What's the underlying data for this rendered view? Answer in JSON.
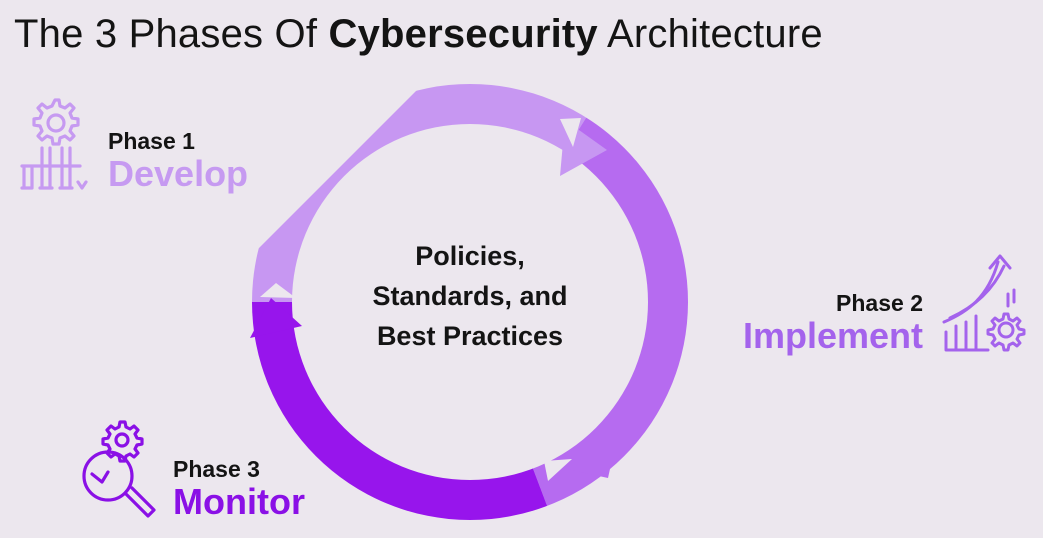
{
  "title": {
    "prefix": "The 3 Phases Of",
    "emphasis": "Cybersecurity",
    "suffix": "Architecture"
  },
  "center": {
    "line1": "Policies,",
    "line2": "Standards, and",
    "line3": "Best Practices"
  },
  "phases": [
    {
      "number": "Phase 1",
      "name": "Develop",
      "color": "#C69AF1",
      "icon": "gear-pillars-icon"
    },
    {
      "number": "Phase 2",
      "name": "Implement",
      "color": "#A463EC",
      "icon": "growth-gear-icon"
    },
    {
      "number": "Phase 3",
      "name": "Monitor",
      "color": "#8A10E6",
      "icon": "magnifier-gear-icon"
    }
  ],
  "colors": {
    "background": "#ECE7EE",
    "segment1": "#C797F2",
    "segment2": "#B66BF0",
    "segment3": "#9715EC"
  }
}
